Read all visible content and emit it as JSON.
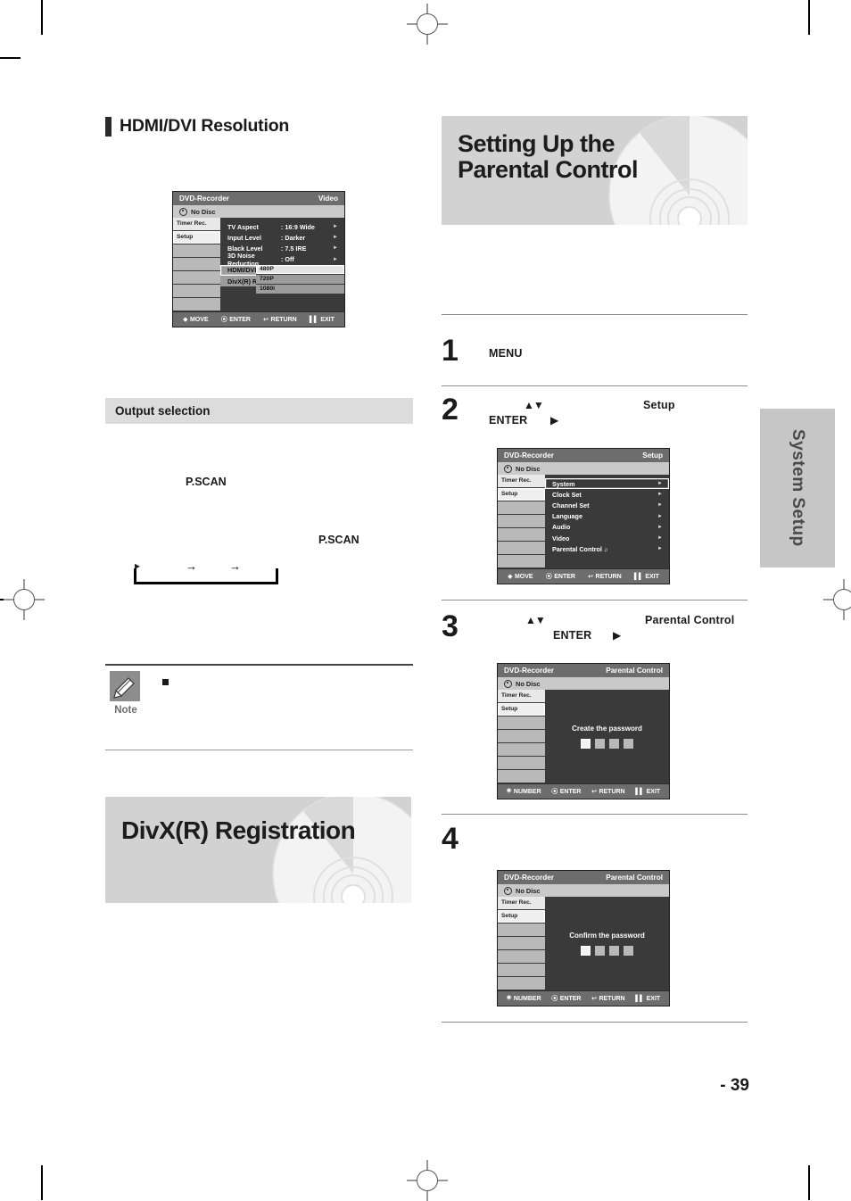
{
  "page": {
    "number": "- 39",
    "side_tab": "System Setup"
  },
  "left_column": {
    "heading": "HDMI/DVI Resolution",
    "subband": "Output selection",
    "keyword_1": "P.SCAN",
    "keyword_2": "P.SCAN",
    "chain_arrows": [
      "→",
      "→",
      "→"
    ],
    "note_label": "Note",
    "banner_title": "DivX(R) Registration",
    "osd": {
      "title_left": "DVD-Recorder",
      "title_right": "Video",
      "disc_status": "No Disc",
      "side_items": [
        "Timer Rec.",
        "Setup"
      ],
      "menu": [
        {
          "label": "TV Aspect",
          "value": ": 16:9 Wide"
        },
        {
          "label": "Input Level",
          "value": ": Darker"
        },
        {
          "label": "Black Level",
          "value": ": 7.5 IRE"
        },
        {
          "label": "3D Noise Reduction",
          "value": ": Off"
        },
        {
          "label": "HDMI/DVI Resolution",
          "value": ""
        },
        {
          "label": "DivX(R) Registration",
          "value": ""
        }
      ],
      "dropdown": [
        "480P",
        "720P",
        "1080i"
      ],
      "dropdown_selected": "480P",
      "footer": [
        "MOVE",
        "ENTER",
        "RETURN",
        "EXIT"
      ]
    }
  },
  "right_column": {
    "banner_title": "Setting Up the Parental Control",
    "steps": [
      {
        "num": "1",
        "keywords": [
          "MENU"
        ]
      },
      {
        "num": "2",
        "keywords": [
          "ENTER",
          "Setup"
        ],
        "glyphs": [
          "▲▼",
          "▶"
        ]
      },
      {
        "num": "3",
        "keywords": [
          "ENTER",
          "Parental Control"
        ],
        "glyphs": [
          "▲▼",
          "▶"
        ]
      },
      {
        "num": "4",
        "keywords": []
      }
    ],
    "osd_setup": {
      "title_left": "DVD-Recorder",
      "title_right": "Setup",
      "disc_status": "No Disc",
      "side_items": [
        "Timer Rec.",
        "Setup"
      ],
      "menu": [
        "System",
        "Clock Set",
        "Channel Set",
        "Language",
        "Audio",
        "Video",
        "Parental Control"
      ],
      "menu_selected": "System",
      "footer": [
        "MOVE",
        "ENTER",
        "RETURN",
        "EXIT"
      ]
    },
    "osd_create": {
      "title_left": "DVD-Recorder",
      "title_right": "Parental Control",
      "disc_status": "No Disc",
      "side_items": [
        "Timer Rec.",
        "Setup"
      ],
      "caption": "Create the password",
      "digit_count": 4,
      "footer": [
        "NUMBER",
        "ENTER",
        "RETURN",
        "EXIT"
      ]
    },
    "osd_confirm": {
      "title_left": "DVD-Recorder",
      "title_right": "Parental Control",
      "disc_status": "No Disc",
      "side_items": [
        "Timer Rec.",
        "Setup"
      ],
      "caption": "Confirm the password",
      "digit_count": 4,
      "footer": [
        "NUMBER",
        "ENTER",
        "RETURN",
        "EXIT"
      ]
    }
  },
  "colors": {
    "banner_grey": "#d2d2d2",
    "subband_grey": "#dcdcdc",
    "osd_dark": "#3a3a3a",
    "osd_title": "#6d6d6d",
    "tab_grey": "#c6c6c6"
  }
}
